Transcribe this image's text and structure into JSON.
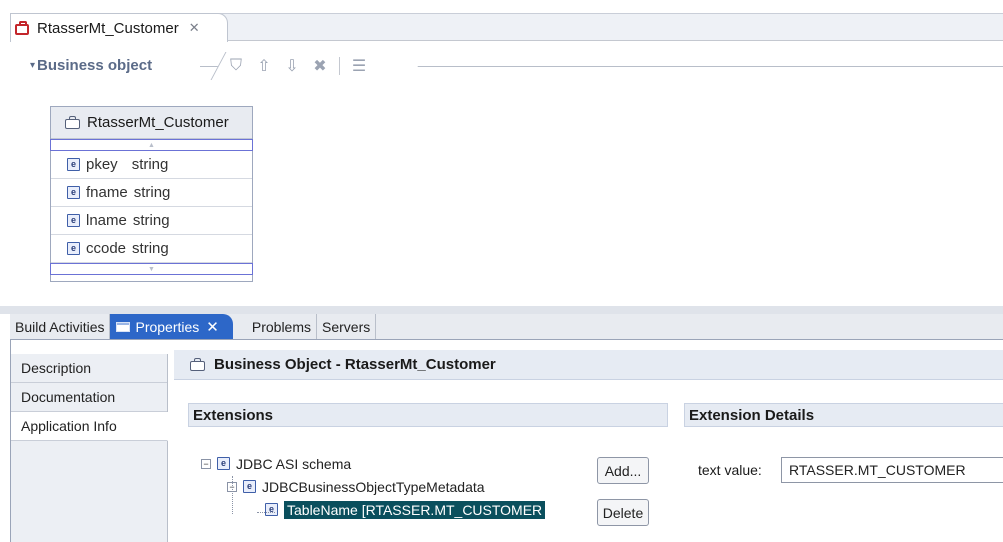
{
  "editor": {
    "tab_title": "RtasserMt_Customer",
    "section_label": "Business object",
    "bo_box": {
      "title": "RtasserMt_Customer",
      "fields": [
        {
          "name": "pkey",
          "type": "string"
        },
        {
          "name": "fname",
          "type": "string"
        },
        {
          "name": "lname",
          "type": "string"
        },
        {
          "name": "ccode",
          "type": "string"
        }
      ]
    }
  },
  "views": {
    "tabs": [
      {
        "label": "Build Activities"
      },
      {
        "label": "Properties",
        "active": true
      },
      {
        "label": "Problems"
      },
      {
        "label": "Servers"
      }
    ]
  },
  "properties": {
    "side_tabs": [
      "Description",
      "Documentation",
      "Application Info"
    ],
    "selected_side_tab": "Application Info",
    "title": "Business Object - RtasserMt_Customer",
    "extensions_header": "Extensions",
    "extension_details_header": "Extension Details",
    "tree": [
      {
        "label": "JDBC ASI schema"
      },
      {
        "label": "JDBCBusinessObjectTypeMetadata"
      },
      {
        "label": "TableName [RTASSER.MT_CUSTOMER"
      }
    ],
    "add_label": "Add...",
    "delete_label": "Delete",
    "text_value_label": "text value:",
    "text_value": "RTASSER.MT_CUSTOMER"
  },
  "colors": {
    "accent": "#2d67c8",
    "selection": "#0a4f5d"
  }
}
